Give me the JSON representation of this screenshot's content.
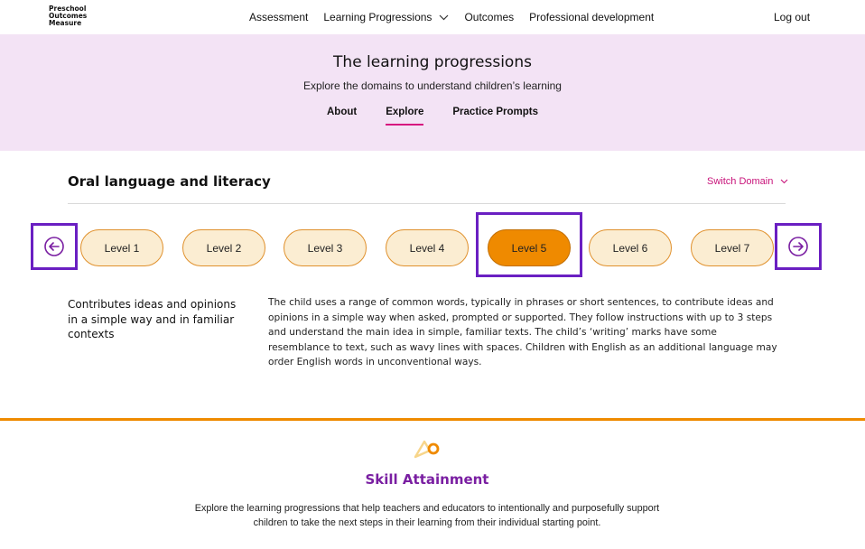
{
  "logo": {
    "line1": "Preschool",
    "line2": "Outcomes",
    "line3": "Measure"
  },
  "nav": {
    "items": [
      {
        "label": "Assessment"
      },
      {
        "label": "Learning Progressions",
        "icon": "chevron-down-icon"
      },
      {
        "label": "Outcomes"
      },
      {
        "label": "Professional development"
      }
    ],
    "logout": "Log out"
  },
  "hero": {
    "title": "The learning progressions",
    "subtitle": "Explore the domains to understand children’s learning",
    "tabs": [
      {
        "label": "About"
      },
      {
        "label": "Explore",
        "active": true
      },
      {
        "label": "Practice Prompts"
      }
    ]
  },
  "domain": {
    "title": "Oral language and literacy",
    "switch_label": "Switch Domain"
  },
  "levels": {
    "items": [
      "Level 1",
      "Level 2",
      "Level 3",
      "Level 4",
      "Level 5",
      "Level 6",
      "Level 7"
    ],
    "active_index": 4
  },
  "content": {
    "heading": "Contributes ideas and opinions in a simple way and in familiar contexts",
    "description": "The child uses a range of common words, typically in phrases or short sentences, to contribute ideas and opinions in a simple way when asked, prompted or supported. They follow instructions with up to 3 steps and understand the main idea in simple, familiar texts. The child’s ‘writing’ marks have some resemblance to text, such as wavy lines with spaces. Children with English as an additional language may order English words in unconventional ways."
  },
  "skill": {
    "title": "Skill Attainment",
    "text": "Explore the learning progressions that help teachers and educators to intentionally and purposefully support children to take the next steps in their learning from their individual starting point."
  },
  "colors": {
    "hero_bg": "#f3e3f5",
    "accent_pink": "#d6137f",
    "accent_purple": "#6a1fc2",
    "level_active": "#ef8a00",
    "level_bg": "#fbedd2",
    "skill_title": "#7a1fa2"
  }
}
